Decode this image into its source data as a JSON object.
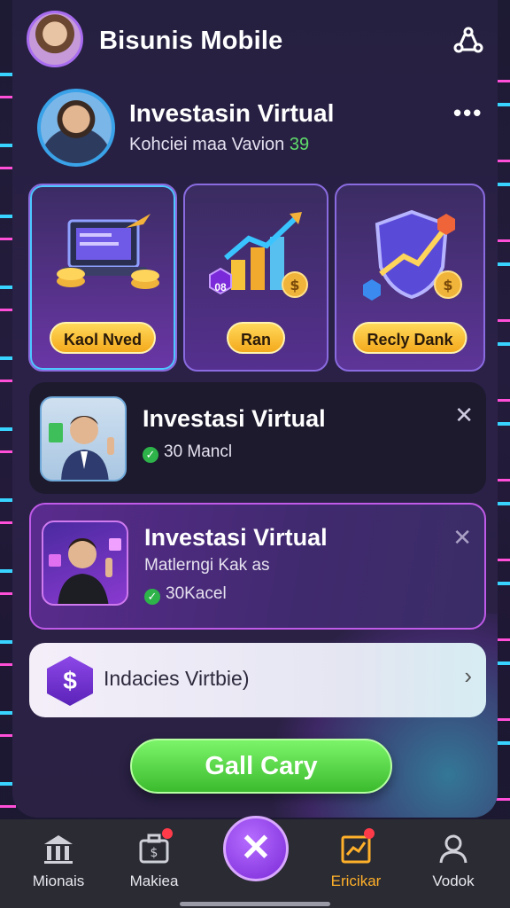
{
  "header": {
    "title": "Bisunis Mobile",
    "share_icon": "share-icon"
  },
  "profile": {
    "name": "Investasin Virtual",
    "subtitle": "Kohciei maa Vavion",
    "subtitle_number": "39",
    "more": "•••"
  },
  "features": [
    {
      "label": "Kaol Nved",
      "icon": "laptop-coins-icon"
    },
    {
      "label": "Ran",
      "icon": "growth-chart-icon"
    },
    {
      "label": "Recly Dank",
      "icon": "shield-chart-icon"
    }
  ],
  "feature_chart_badge": "08",
  "cards": [
    {
      "title": "Investasi Virtual",
      "status": "30 Mancl",
      "close": "✕"
    },
    {
      "title": "Investasi Virtual",
      "subtitle": "Matlerngi Kak as",
      "status": "30Kacel",
      "close": "✕"
    }
  ],
  "row": {
    "icon_text": "$",
    "label": "Indacies Virtbie)",
    "chevron": "›"
  },
  "cta": {
    "label": "Gall Cary"
  },
  "nav": {
    "items": [
      {
        "label": "Mionais",
        "icon": "bank-icon",
        "badge": false
      },
      {
        "label": "Makiea",
        "icon": "briefcase-icon",
        "badge": true
      },
      {
        "label": "Ericikar",
        "icon": "chart-frame-icon",
        "badge": true,
        "active": true
      },
      {
        "label": "Vodok",
        "icon": "person-icon",
        "badge": false
      }
    ],
    "center": "✕"
  },
  "colors": {
    "accent_purple": "#7a2ad8",
    "cta_green": "#3cbb2e",
    "button_gold": "#f4a91c",
    "active_nav": "#ffb02a"
  }
}
